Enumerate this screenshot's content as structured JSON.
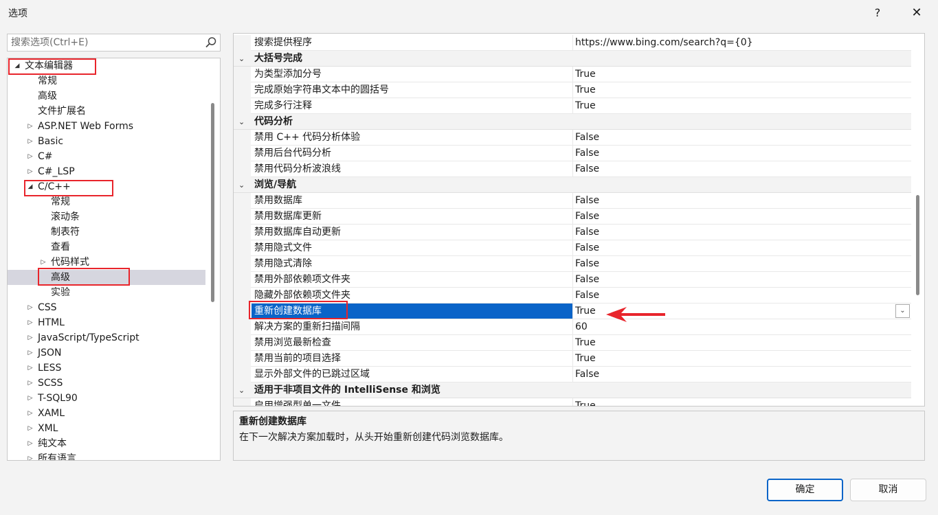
{
  "window": {
    "title": "选项",
    "help": "?",
    "close": "✕"
  },
  "search": {
    "placeholder": "搜索选项(Ctrl+E)"
  },
  "tree": {
    "items": [
      {
        "label": "文本编辑器",
        "level": 0,
        "expanded": true,
        "has_children": true
      },
      {
        "label": "常规",
        "level": 1,
        "has_children": false
      },
      {
        "label": "高级",
        "level": 1,
        "has_children": false
      },
      {
        "label": "文件扩展名",
        "level": 1,
        "has_children": false
      },
      {
        "label": "ASP.NET Web Forms",
        "level": 1,
        "has_children": true
      },
      {
        "label": "Basic",
        "level": 1,
        "has_children": true
      },
      {
        "label": "C#",
        "level": 1,
        "has_children": true
      },
      {
        "label": "C#_LSP",
        "level": 1,
        "has_children": true
      },
      {
        "label": "C/C++",
        "level": 1,
        "expanded": true,
        "has_children": true
      },
      {
        "label": "常规",
        "level": 2,
        "has_children": false
      },
      {
        "label": "滚动条",
        "level": 2,
        "has_children": false
      },
      {
        "label": "制表符",
        "level": 2,
        "has_children": false
      },
      {
        "label": "查看",
        "level": 2,
        "has_children": false
      },
      {
        "label": "代码样式",
        "level": 2,
        "has_children": true
      },
      {
        "label": "高级",
        "level": 2,
        "has_children": false,
        "selected": true
      },
      {
        "label": "实验",
        "level": 2,
        "has_children": false
      },
      {
        "label": "CSS",
        "level": 1,
        "has_children": true
      },
      {
        "label": "HTML",
        "level": 1,
        "has_children": true
      },
      {
        "label": "JavaScript/TypeScript",
        "level": 1,
        "has_children": true
      },
      {
        "label": "JSON",
        "level": 1,
        "has_children": true
      },
      {
        "label": "LESS",
        "level": 1,
        "has_children": true
      },
      {
        "label": "SCSS",
        "level": 1,
        "has_children": true
      },
      {
        "label": "T-SQL90",
        "level": 1,
        "has_children": true
      },
      {
        "label": "XAML",
        "level": 1,
        "has_children": true
      },
      {
        "label": "XML",
        "level": 1,
        "has_children": true
      },
      {
        "label": "纯文本",
        "level": 1,
        "has_children": true
      },
      {
        "label": "所有语言",
        "level": 1,
        "has_children": true
      }
    ]
  },
  "grid": {
    "rows": [
      {
        "type": "prop",
        "name": "搜索提供程序",
        "value": "https://www.bing.com/search?q={0}"
      },
      {
        "type": "cat",
        "name": "大括号完成"
      },
      {
        "type": "prop",
        "name": "为类型添加分号",
        "value": "True"
      },
      {
        "type": "prop",
        "name": "完成原始字符串文本中的圆括号",
        "value": "True"
      },
      {
        "type": "prop",
        "name": "完成多行注释",
        "value": "True"
      },
      {
        "type": "cat",
        "name": "代码分析"
      },
      {
        "type": "prop",
        "name": "禁用 C++ 代码分析体验",
        "value": "False"
      },
      {
        "type": "prop",
        "name": "禁用后台代码分析",
        "value": "False"
      },
      {
        "type": "prop",
        "name": "禁用代码分析波浪线",
        "value": "False"
      },
      {
        "type": "cat",
        "name": "浏览/导航"
      },
      {
        "type": "prop",
        "name": "禁用数据库",
        "value": "False"
      },
      {
        "type": "prop",
        "name": "禁用数据库更新",
        "value": "False"
      },
      {
        "type": "prop",
        "name": "禁用数据库自动更新",
        "value": "False"
      },
      {
        "type": "prop",
        "name": "禁用隐式文件",
        "value": "False"
      },
      {
        "type": "prop",
        "name": "禁用隐式清除",
        "value": "False"
      },
      {
        "type": "prop",
        "name": "禁用外部依赖项文件夹",
        "value": "False"
      },
      {
        "type": "prop",
        "name": "隐藏外部依赖项文件夹",
        "value": "False"
      },
      {
        "type": "prop",
        "name": "重新创建数据库",
        "value": "True",
        "selected": true
      },
      {
        "type": "prop",
        "name": "解决方案的重新扫描间隔",
        "value": "60"
      },
      {
        "type": "prop",
        "name": "禁用浏览最新检查",
        "value": "True"
      },
      {
        "type": "prop",
        "name": "禁用当前的项目选择",
        "value": "True"
      },
      {
        "type": "prop",
        "name": "显示外部文件的已跳过区域",
        "value": "False"
      },
      {
        "type": "cat",
        "name": "适用于非项目文件的 IntelliSense 和浏览"
      },
      {
        "type": "prop",
        "name": "启用增强型单一文件",
        "value": "True"
      }
    ]
  },
  "description": {
    "title": "重新创建数据库",
    "text": "在下一次解决方案加载时，从头开始重新创建代码浏览数据库。"
  },
  "buttons": {
    "ok": "确定",
    "cancel": "取消"
  },
  "colors": {
    "selection": "#0a64c8",
    "annotation": "#e8242b"
  }
}
